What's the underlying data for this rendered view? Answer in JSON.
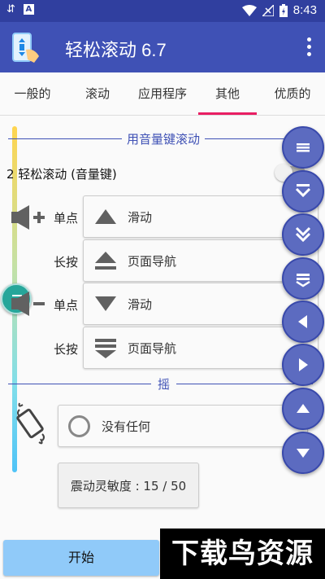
{
  "status_bar": {
    "time": "8:43",
    "app_badge": "A"
  },
  "app_bar": {
    "title": "轻松滚动 6.7",
    "overflow": "more-vert-icon"
  },
  "tabs": [
    {
      "label": "一般的",
      "active": false
    },
    {
      "label": "滚动",
      "active": false
    },
    {
      "label": "应用程序",
      "active": false
    },
    {
      "label": "其他",
      "active": true
    },
    {
      "label": "优质的",
      "active": false
    }
  ],
  "volume_section": {
    "header": "用音量键滚动",
    "option_label": "2 轻松滚动 (音量键)",
    "toggle_on": false,
    "rows": [
      {
        "press": "单点",
        "action": "滑动",
        "icon": "triangle-up-icon"
      },
      {
        "press": "长按",
        "action": "页面导航",
        "icon": "eject-icon"
      },
      {
        "press": "单点",
        "action": "滑动",
        "icon": "triangle-down-icon"
      },
      {
        "press": "长按",
        "action": "页面导航",
        "icon": "double-bar-down-icon"
      }
    ]
  },
  "shake_section": {
    "header": "摇",
    "choice": "没有任何",
    "sensitivity_label": "震动灵敏度 : 15 / 50"
  },
  "start_button": "开始",
  "watermark": "下载鸟资源",
  "fabs": [
    "menu-icon",
    "chevron-down-icon",
    "double-chevron-down-icon",
    "bar-chevron-down-icon",
    "arrow-left-icon",
    "arrow-right-icon",
    "arrow-up-icon",
    "arrow-down-icon"
  ],
  "colors": {
    "primary": "#3f51b5",
    "primary_dark": "#303f9f",
    "accent": "#e91e63",
    "fab": "#5c6bc0",
    "start_button": "#90caf9"
  }
}
